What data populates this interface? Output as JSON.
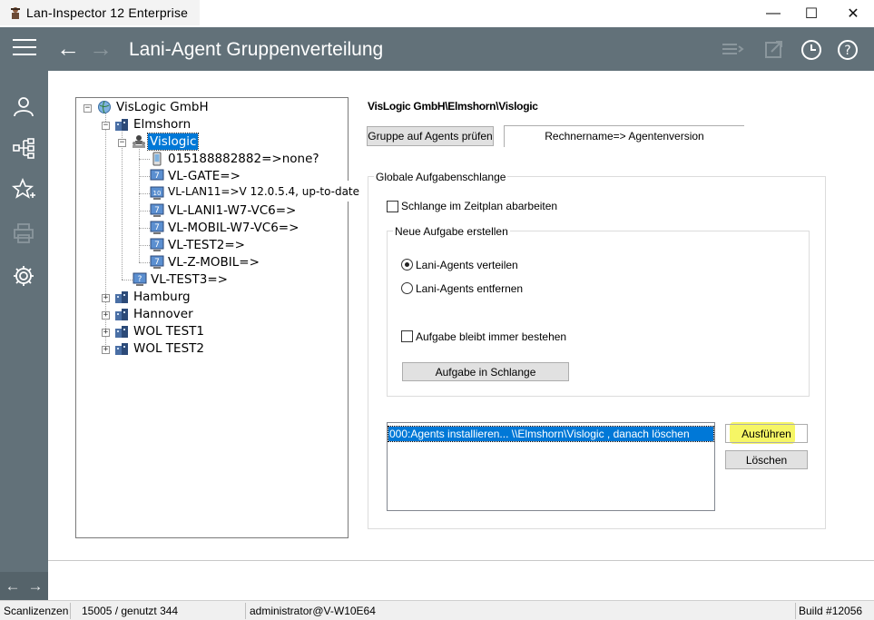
{
  "window": {
    "title": "Lan-Inspector 12 Enterprise",
    "minimize": "—",
    "maximize": "☐",
    "close": "✕"
  },
  "header": {
    "title": "Lani-Agent Gruppenverteilung",
    "back": "←",
    "forward": "→"
  },
  "sidebar": {
    "nav_back": "←",
    "nav_forward": "→"
  },
  "tree": {
    "root": "VisLogic GmbH",
    "elmshorn": "Elmshorn",
    "vislogic": "Vislogic",
    "items": [
      "015188882882=>none?",
      "VL-GATE=>",
      "VL-LAN11=>V 12.0.5.4, up-to-date",
      "VL-LANI1-W7-VC6=>",
      "VL-MOBIL-W7-VC6=>",
      "VL-TEST2=>",
      "VL-Z-MOBIL=>"
    ],
    "vltest3": "VL-TEST3=>",
    "groups": [
      "Hamburg",
      "Hannover",
      "WOL TEST1",
      "WOL TEST2"
    ]
  },
  "right": {
    "path": "VisLogic GmbH\\Elmshorn\\Vislogic",
    "check_button": "Gruppe auf Agents prüfen",
    "tab": "Rechnername=> Agentenversion",
    "global_group": "Globale Aufgabenschlange",
    "schedule_check": "Schlange im Zeitplan abarbeiten",
    "new_task_group": "Neue Aufgabe erstellen",
    "radio_distribute": "Lani-Agents verteilen",
    "radio_remove": "Lani-Agents entfernen",
    "persist_check": "Aufgabe bleibt immer bestehen",
    "queue_button": "Aufgabe in Schlange",
    "queue_items": [
      "000:Agents installieren... \\\\Elmshorn\\Vislogic  , danach löschen"
    ],
    "run_button": "Ausführen",
    "delete_button": "Löschen"
  },
  "status": {
    "licenses_label": "Scanlizenzen",
    "licenses_value": "15005 / genutzt 344",
    "user": "administrator@V-W10E64",
    "build": "Build #12056"
  },
  "colors": {
    "header_bg": "#627179",
    "selection": "#0078d7",
    "highlight": "#f5f54a"
  }
}
